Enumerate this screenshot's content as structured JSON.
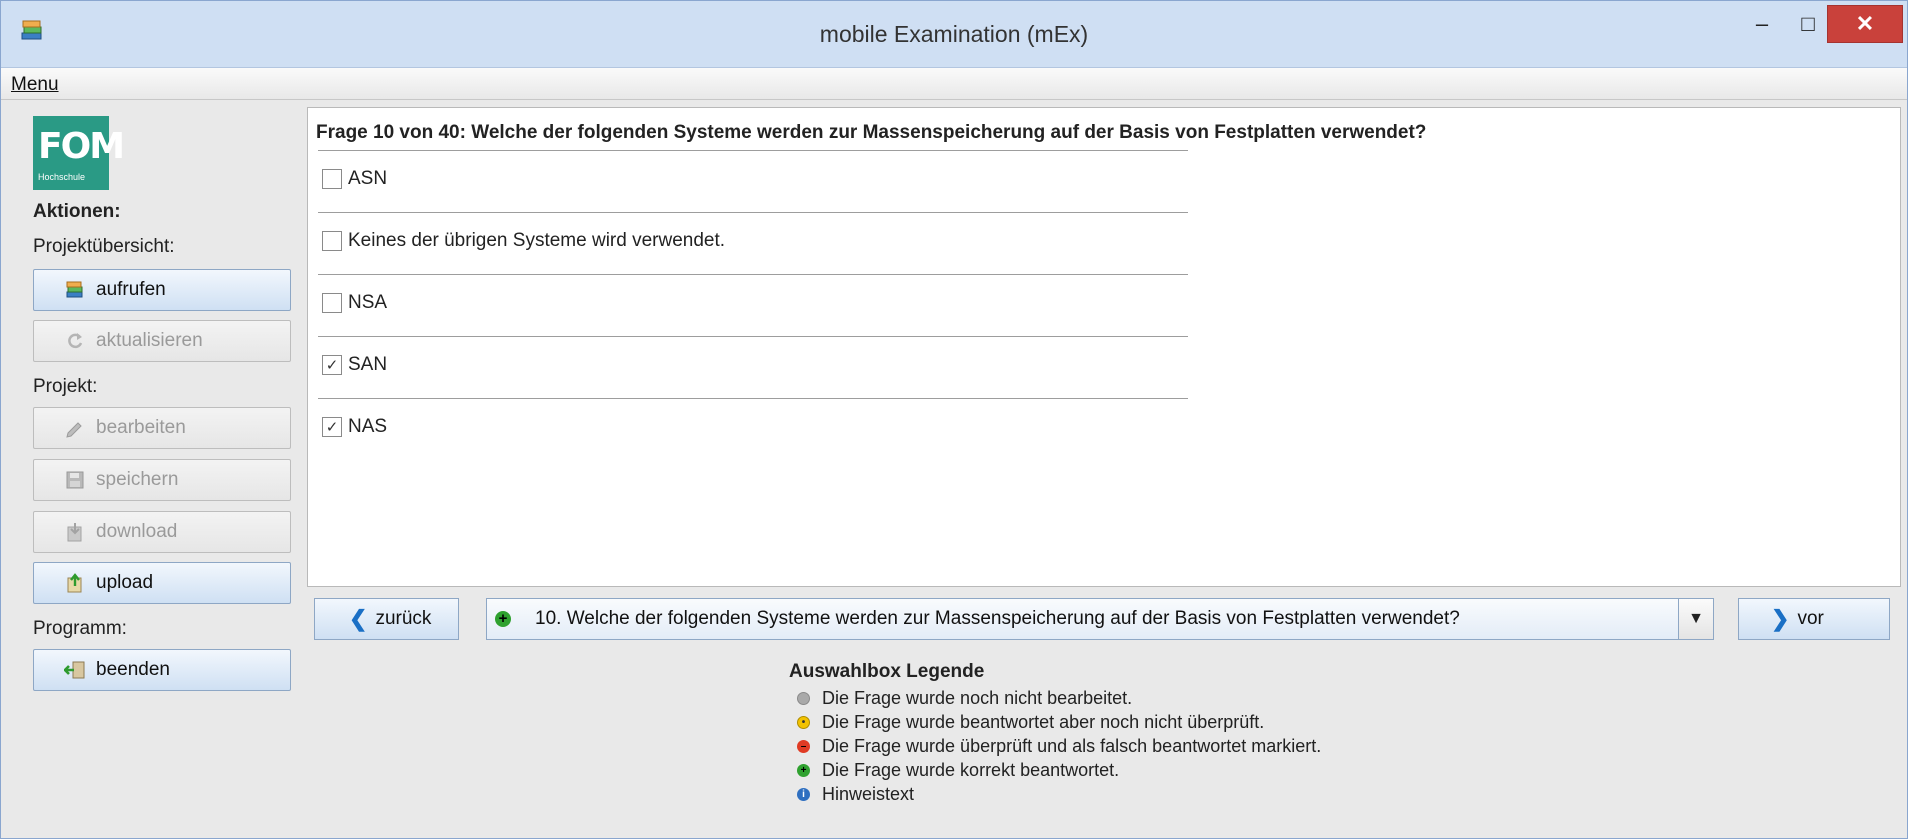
{
  "window": {
    "title": "mobile Examination (mEx)",
    "controls": {
      "minimize": "–",
      "maximize": "□",
      "close": "✕"
    }
  },
  "menubar": {
    "items": [
      {
        "label": "Menu"
      }
    ]
  },
  "sidebar": {
    "logo": {
      "main": "FOM",
      "sub": "Hochschule"
    },
    "actions_heading": "Aktionen:",
    "project_overview_label": "Projektübersicht:",
    "project_label": "Projekt:",
    "program_label": "Programm:",
    "buttons": [
      {
        "label": "aufrufen",
        "icon": "books-icon",
        "enabled": true
      },
      {
        "label": "aktualisieren",
        "icon": "refresh-icon",
        "enabled": false
      },
      {
        "label": "bearbeiten",
        "icon": "pencil-icon",
        "enabled": false
      },
      {
        "label": "speichern",
        "icon": "floppy-disk-icon",
        "enabled": false
      },
      {
        "label": "download",
        "icon": "download-icon",
        "enabled": false
      },
      {
        "label": "upload",
        "icon": "upload-icon",
        "enabled": true
      },
      {
        "label": "beenden",
        "icon": "exit-icon",
        "enabled": true
      }
    ]
  },
  "question": {
    "title": "Frage 10 von 40: Welche der folgenden Systeme werden zur Massenspeicherung auf der Basis von Festplatten verwendet?",
    "options": [
      {
        "label": "ASN",
        "checked": false
      },
      {
        "label": "Keines der übrigen Systeme wird verwendet.",
        "checked": false
      },
      {
        "label": "NSA",
        "checked": false
      },
      {
        "label": "SAN",
        "checked": true
      },
      {
        "label": "NAS",
        "checked": true
      }
    ]
  },
  "navigation": {
    "back_label": "zurück",
    "next_label": "vor",
    "selected_question": "10. Welche der folgenden Systeme werden zur Massenspeicherung auf der Basis von Festplatten verwendet?",
    "selected_status": "korrekt"
  },
  "legend": {
    "title": "Auswahlbox Legende",
    "items": [
      {
        "text": "Die Frage wurde noch nicht bearbeitet.",
        "color": "#a9a9a9",
        "symbol": ""
      },
      {
        "text": "Die Frage wurde beantwortet aber noch nicht überprüft.",
        "color": "#f2c200",
        "symbol": "•"
      },
      {
        "text": "Die Frage wurde überprüft und als falsch beantwortet markiert.",
        "color": "#e03b24",
        "symbol": "–"
      },
      {
        "text": "Die Frage wurde korrekt beantwortet.",
        "color": "#2fa12f",
        "symbol": "+"
      },
      {
        "text": "Hinweistext",
        "color": "#2f6fc0",
        "symbol": "i"
      }
    ]
  },
  "colors": {
    "title_bar": "#cfdff3",
    "close_button": "#c9413b",
    "logo": "#2a9a85",
    "button_accent": "#1a6fc5"
  }
}
